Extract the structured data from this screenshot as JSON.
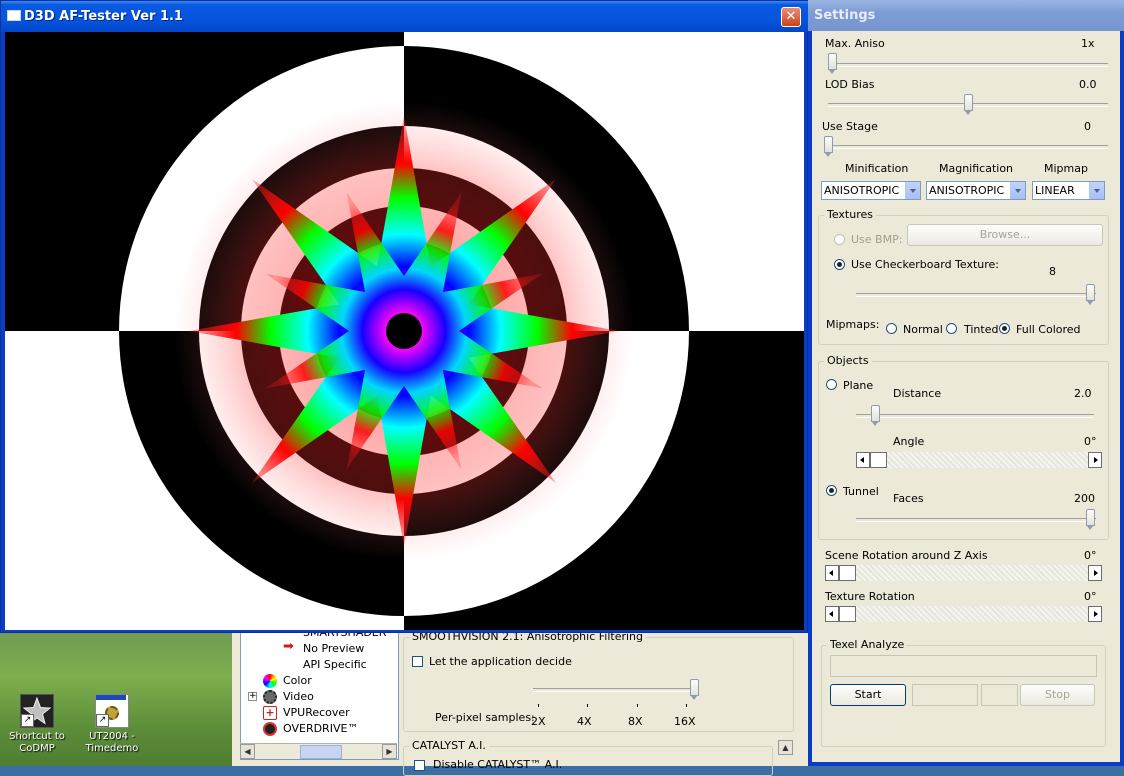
{
  "main_window": {
    "title": "D3D AF-Tester Ver 1.1",
    "close_glyph": "✕"
  },
  "desktop": {
    "icons": [
      {
        "label_line1": "Shortcut to",
        "label_line2": "CoDMP"
      },
      {
        "label_line1": "UT2004 -",
        "label_line2": "Timedemo"
      }
    ]
  },
  "catalyst": {
    "tree_items": [
      {
        "label": "SMARTSHADER™"
      },
      {
        "label": "No Preview"
      },
      {
        "label": "API Specific"
      },
      {
        "label": "Color"
      },
      {
        "label": "Video"
      },
      {
        "label": "VPURecover"
      },
      {
        "label": "OVERDRIVE™"
      }
    ],
    "smoothvision_title": "SMOOTHVISION 2.1: Anisotrophic Filtering",
    "let_app_decide": "Let the application decide",
    "per_pixel_label": "Per-pixel samples:",
    "sample_ticks": [
      "2X",
      "4X",
      "8X",
      "16X"
    ],
    "per_pixel_value": "16X",
    "catalyst_ai_title": "CATALYST A.I.",
    "disable_ai": "Disable CATALYST™ A.I."
  },
  "settings": {
    "title": "Settings",
    "max_aniso": {
      "label": "Max. Aniso",
      "value": "1x"
    },
    "lod_bias": {
      "label": "LOD Bias",
      "value": "0.0"
    },
    "use_stage": {
      "label": "Use Stage",
      "value": "0"
    },
    "filters": {
      "minification": {
        "label": "Minification",
        "value": "ANISOTROPIC"
      },
      "magnification": {
        "label": "Magnification",
        "value": "ANISOTROPIC"
      },
      "mipmap": {
        "label": "Mipmap",
        "value": "LINEAR"
      }
    },
    "textures": {
      "title": "Textures",
      "use_bmp": "Use BMP:",
      "browse": "Browse...",
      "use_checker": "Use Checkerboard Texture:",
      "checker_value": "8",
      "mipmaps_label": "Mipmaps:",
      "mip_normal": "Normal",
      "mip_tinted": "Tinted",
      "mip_full": "Full Colored",
      "selected_mipmaps": "Full Colored"
    },
    "objects": {
      "title": "Objects",
      "plane": "Plane",
      "distance": {
        "label": "Distance",
        "value": "2.0"
      },
      "angle": {
        "label": "Angle",
        "value": "0°"
      },
      "tunnel": "Tunnel",
      "faces": {
        "label": "Faces",
        "value": "200"
      },
      "selected": "Tunnel"
    },
    "scene_rotation": {
      "label": "Scene Rotation around Z Axis",
      "value": "0°"
    },
    "texture_rotation": {
      "label": "Texture Rotation",
      "value": "0°"
    },
    "texel": {
      "title": "Texel Analyze",
      "start": "Start",
      "stop": "Stop"
    }
  },
  "colors": {
    "xp_blue": "#0a3cc6",
    "dialog_bg": "#ece9d8",
    "inactive_title": "#7d9bd4"
  }
}
